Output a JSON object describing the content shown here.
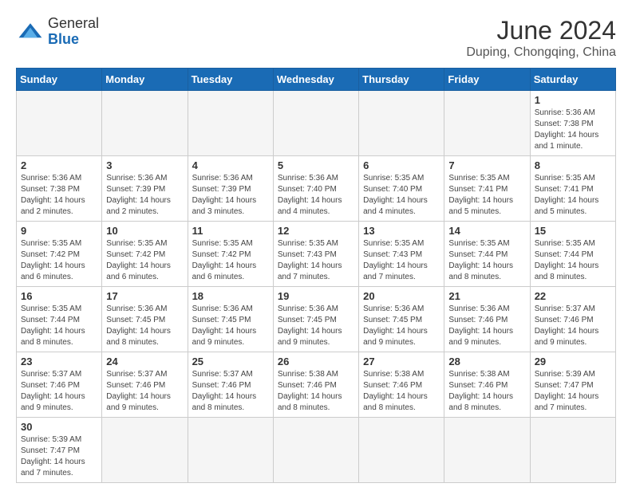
{
  "header": {
    "logo_general": "General",
    "logo_blue": "Blue",
    "title": "June 2024",
    "location": "Duping, Chongqing, China"
  },
  "weekdays": [
    "Sunday",
    "Monday",
    "Tuesday",
    "Wednesday",
    "Thursday",
    "Friday",
    "Saturday"
  ],
  "days": [
    {
      "num": "",
      "info": ""
    },
    {
      "num": "",
      "info": ""
    },
    {
      "num": "",
      "info": ""
    },
    {
      "num": "",
      "info": ""
    },
    {
      "num": "",
      "info": ""
    },
    {
      "num": "",
      "info": ""
    },
    {
      "num": "1",
      "info": "Sunrise: 5:36 AM\nSunset: 7:38 PM\nDaylight: 14 hours\nand 1 minute."
    },
    {
      "num": "2",
      "info": "Sunrise: 5:36 AM\nSunset: 7:38 PM\nDaylight: 14 hours\nand 2 minutes."
    },
    {
      "num": "3",
      "info": "Sunrise: 5:36 AM\nSunset: 7:39 PM\nDaylight: 14 hours\nand 2 minutes."
    },
    {
      "num": "4",
      "info": "Sunrise: 5:36 AM\nSunset: 7:39 PM\nDaylight: 14 hours\nand 3 minutes."
    },
    {
      "num": "5",
      "info": "Sunrise: 5:36 AM\nSunset: 7:40 PM\nDaylight: 14 hours\nand 4 minutes."
    },
    {
      "num": "6",
      "info": "Sunrise: 5:35 AM\nSunset: 7:40 PM\nDaylight: 14 hours\nand 4 minutes."
    },
    {
      "num": "7",
      "info": "Sunrise: 5:35 AM\nSunset: 7:41 PM\nDaylight: 14 hours\nand 5 minutes."
    },
    {
      "num": "8",
      "info": "Sunrise: 5:35 AM\nSunset: 7:41 PM\nDaylight: 14 hours\nand 5 minutes."
    },
    {
      "num": "9",
      "info": "Sunrise: 5:35 AM\nSunset: 7:42 PM\nDaylight: 14 hours\nand 6 minutes."
    },
    {
      "num": "10",
      "info": "Sunrise: 5:35 AM\nSunset: 7:42 PM\nDaylight: 14 hours\nand 6 minutes."
    },
    {
      "num": "11",
      "info": "Sunrise: 5:35 AM\nSunset: 7:42 PM\nDaylight: 14 hours\nand 6 minutes."
    },
    {
      "num": "12",
      "info": "Sunrise: 5:35 AM\nSunset: 7:43 PM\nDaylight: 14 hours\nand 7 minutes."
    },
    {
      "num": "13",
      "info": "Sunrise: 5:35 AM\nSunset: 7:43 PM\nDaylight: 14 hours\nand 7 minutes."
    },
    {
      "num": "14",
      "info": "Sunrise: 5:35 AM\nSunset: 7:44 PM\nDaylight: 14 hours\nand 8 minutes."
    },
    {
      "num": "15",
      "info": "Sunrise: 5:35 AM\nSunset: 7:44 PM\nDaylight: 14 hours\nand 8 minutes."
    },
    {
      "num": "16",
      "info": "Sunrise: 5:35 AM\nSunset: 7:44 PM\nDaylight: 14 hours\nand 8 minutes."
    },
    {
      "num": "17",
      "info": "Sunrise: 5:36 AM\nSunset: 7:45 PM\nDaylight: 14 hours\nand 8 minutes."
    },
    {
      "num": "18",
      "info": "Sunrise: 5:36 AM\nSunset: 7:45 PM\nDaylight: 14 hours\nand 9 minutes."
    },
    {
      "num": "19",
      "info": "Sunrise: 5:36 AM\nSunset: 7:45 PM\nDaylight: 14 hours\nand 9 minutes."
    },
    {
      "num": "20",
      "info": "Sunrise: 5:36 AM\nSunset: 7:45 PM\nDaylight: 14 hours\nand 9 minutes."
    },
    {
      "num": "21",
      "info": "Sunrise: 5:36 AM\nSunset: 7:46 PM\nDaylight: 14 hours\nand 9 minutes."
    },
    {
      "num": "22",
      "info": "Sunrise: 5:37 AM\nSunset: 7:46 PM\nDaylight: 14 hours\nand 9 minutes."
    },
    {
      "num": "23",
      "info": "Sunrise: 5:37 AM\nSunset: 7:46 PM\nDaylight: 14 hours\nand 9 minutes."
    },
    {
      "num": "24",
      "info": "Sunrise: 5:37 AM\nSunset: 7:46 PM\nDaylight: 14 hours\nand 9 minutes."
    },
    {
      "num": "25",
      "info": "Sunrise: 5:37 AM\nSunset: 7:46 PM\nDaylight: 14 hours\nand 8 minutes."
    },
    {
      "num": "26",
      "info": "Sunrise: 5:38 AM\nSunset: 7:46 PM\nDaylight: 14 hours\nand 8 minutes."
    },
    {
      "num": "27",
      "info": "Sunrise: 5:38 AM\nSunset: 7:46 PM\nDaylight: 14 hours\nand 8 minutes."
    },
    {
      "num": "28",
      "info": "Sunrise: 5:38 AM\nSunset: 7:46 PM\nDaylight: 14 hours\nand 8 minutes."
    },
    {
      "num": "29",
      "info": "Sunrise: 5:39 AM\nSunset: 7:47 PM\nDaylight: 14 hours\nand 7 minutes."
    },
    {
      "num": "30",
      "info": "Sunrise: 5:39 AM\nSunset: 7:47 PM\nDaylight: 14 hours\nand 7 minutes."
    }
  ]
}
